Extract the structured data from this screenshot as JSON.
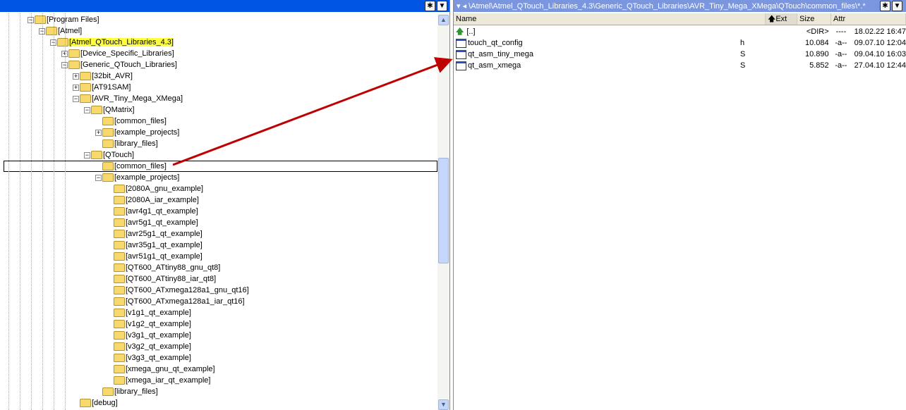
{
  "left": {
    "title": "",
    "tree": [
      {
        "label": "[Program Files]",
        "level": 0,
        "exp": "-"
      },
      {
        "label": "[Atmel]",
        "level": 1,
        "exp": "-"
      },
      {
        "label": "[Atmel_QTouch_Libraries_4.3]",
        "level": 2,
        "exp": "-",
        "highlight": true
      },
      {
        "label": "[Device_Specific_Libraries]",
        "level": 3,
        "exp": "+"
      },
      {
        "label": "[Generic_QTouch_Libraries]",
        "level": 3,
        "exp": "-"
      },
      {
        "label": "[32bit_AVR]",
        "level": 4,
        "exp": "+"
      },
      {
        "label": "[AT91SAM]",
        "level": 4,
        "exp": "+"
      },
      {
        "label": "[AVR_Tiny_Mega_XMega]",
        "level": 4,
        "exp": "-"
      },
      {
        "label": "[QMatrix]",
        "level": 5,
        "exp": "-"
      },
      {
        "label": "[common_files]",
        "level": 6,
        "exp": ""
      },
      {
        "label": "[example_projects]",
        "level": 6,
        "exp": "+"
      },
      {
        "label": "[library_files]",
        "level": 6,
        "exp": ""
      },
      {
        "label": "[QTouch]",
        "level": 5,
        "exp": "-"
      },
      {
        "label": "[common_files]",
        "level": 6,
        "exp": "",
        "selected": true
      },
      {
        "label": "[example_projects]",
        "level": 6,
        "exp": "-"
      },
      {
        "label": "[2080A_gnu_example]",
        "level": 7,
        "exp": ""
      },
      {
        "label": "[2080A_iar_example]",
        "level": 7,
        "exp": ""
      },
      {
        "label": "[avr4g1_qt_example]",
        "level": 7,
        "exp": ""
      },
      {
        "label": "[avr5g1_qt_example]",
        "level": 7,
        "exp": ""
      },
      {
        "label": "[avr25g1_qt_example]",
        "level": 7,
        "exp": ""
      },
      {
        "label": "[avr35g1_qt_example]",
        "level": 7,
        "exp": ""
      },
      {
        "label": "[avr51g1_qt_example]",
        "level": 7,
        "exp": ""
      },
      {
        "label": "[QT600_ATtiny88_gnu_qt8]",
        "level": 7,
        "exp": ""
      },
      {
        "label": "[QT600_ATtiny88_iar_qt8]",
        "level": 7,
        "exp": ""
      },
      {
        "label": "[QT600_ATxmega128a1_gnu_qt16]",
        "level": 7,
        "exp": ""
      },
      {
        "label": "[QT600_ATxmega128a1_iar_qt16]",
        "level": 7,
        "exp": ""
      },
      {
        "label": "[v1g1_qt_example]",
        "level": 7,
        "exp": ""
      },
      {
        "label": "[v1g2_qt_example]",
        "level": 7,
        "exp": ""
      },
      {
        "label": "[v3g1_qt_example]",
        "level": 7,
        "exp": ""
      },
      {
        "label": "[v3g2_qt_example]",
        "level": 7,
        "exp": ""
      },
      {
        "label": "[v3g3_qt_example]",
        "level": 7,
        "exp": ""
      },
      {
        "label": "[xmega_gnu_qt_example]",
        "level": 7,
        "exp": ""
      },
      {
        "label": "[xmega_iar_qt_example]",
        "level": 7,
        "exp": ""
      },
      {
        "label": "[library_files]",
        "level": 6,
        "exp": ""
      },
      {
        "label": "[debug]",
        "level": 4,
        "exp": ""
      }
    ]
  },
  "right": {
    "path": "\\Atmel\\Atmel_QTouch_Libraries_4.3\\Generic_QTouch_Libraries\\AVR_Tiny_Mega_XMega\\QTouch\\common_files\\*.*",
    "columns": {
      "name": "Name",
      "ext": "Ext",
      "size": "Size",
      "attr": "Attr"
    },
    "files": [
      {
        "name": "[..]",
        "ext": "",
        "size": "<DIR>",
        "attr": "----",
        "date": "18.02.22 16:47",
        "up": true
      },
      {
        "name": "touch_qt_config",
        "ext": "h",
        "size": "10.084",
        "attr": "-a--",
        "date": "09.07.10 12:04"
      },
      {
        "name": "qt_asm_tiny_mega",
        "ext": "S",
        "size": "10.890",
        "attr": "-a--",
        "date": "09.04.10 16:03"
      },
      {
        "name": "qt_asm_xmega",
        "ext": "S",
        "size": "5.852",
        "attr": "-a--",
        "date": "27.04.10 12:44"
      }
    ]
  },
  "buttons": {
    "star": "✱",
    "down": "▼",
    "up_arrow": "▲",
    "scroll_down": "▼"
  }
}
